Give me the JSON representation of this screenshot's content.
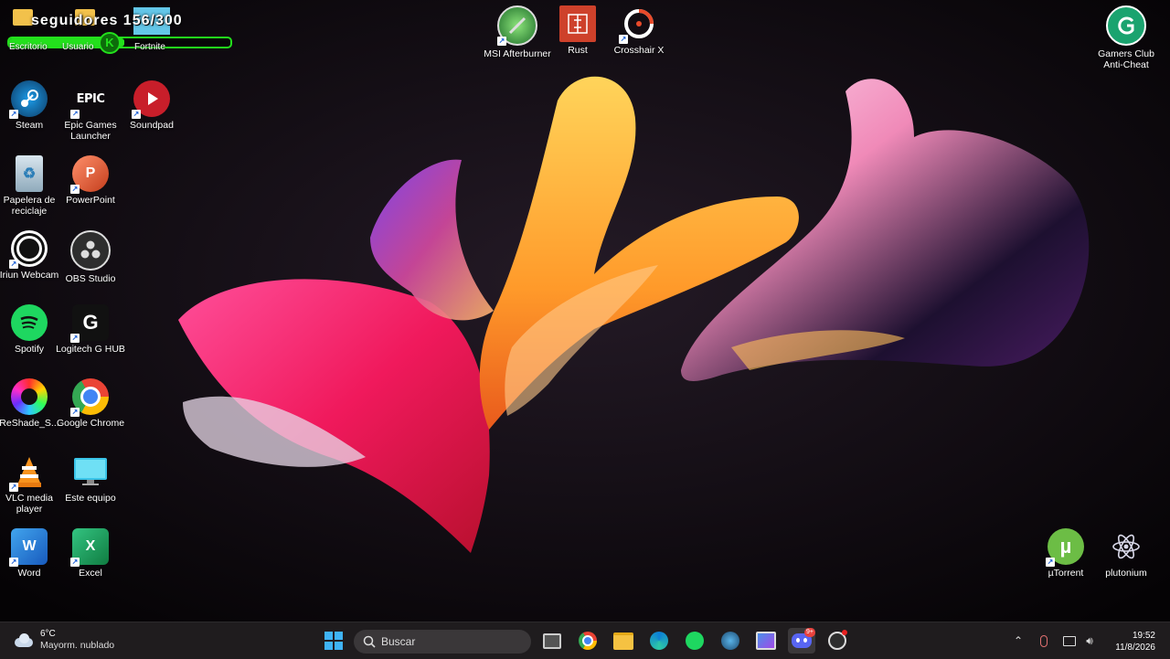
{
  "overlay": {
    "text": "seguidores 156/300",
    "progress": 0.52,
    "badge": "K",
    "underlabels": [
      "Escritorio",
      "Usuario",
      "Fortnite"
    ]
  },
  "desktop": {
    "icons": [
      {
        "label": "Steam"
      },
      {
        "label": "Epic Games Launcher"
      },
      {
        "label": "Soundpad"
      },
      {
        "label": "Papelera de reciclaje"
      },
      {
        "label": "PowerPoint"
      },
      {
        "label": "Iriun Webcam"
      },
      {
        "label": "OBS Studio"
      },
      {
        "label": "Spotify"
      },
      {
        "label": "Logitech G HUB"
      },
      {
        "label": "ReShade_S..."
      },
      {
        "label": "Google Chrome"
      },
      {
        "label": "VLC media player"
      },
      {
        "label": "Este equipo"
      },
      {
        "label": "Word"
      },
      {
        "label": "Excel"
      },
      {
        "label": "MSI Afterburner"
      },
      {
        "label": "Rust"
      },
      {
        "label": "Crosshair X"
      },
      {
        "label": "Gamers Club Anti-Cheat"
      },
      {
        "label": "µTorrent"
      },
      {
        "label": "plutonium"
      }
    ],
    "glyphs": {
      "epic": "EPIC",
      "powerpoint": "P",
      "word": "W",
      "excel": "X",
      "logitech": "G",
      "utorrent": "µ"
    }
  },
  "taskbar": {
    "weather": {
      "temp": "6°C",
      "desc": "Mayorm. nublado"
    },
    "search_placeholder": "Buscar",
    "clock": {
      "time": "19:52",
      "date": "11/8/2026"
    },
    "discord_badge": "9+",
    "apps": [
      "start-button",
      "task-view",
      "chrome",
      "file-explorer",
      "edge",
      "spotify",
      "steam",
      "snipping",
      "discord",
      "obs"
    ]
  },
  "colors": {
    "accent_green": "#23e01c",
    "taskbar_bg": "#1f1c1e"
  }
}
